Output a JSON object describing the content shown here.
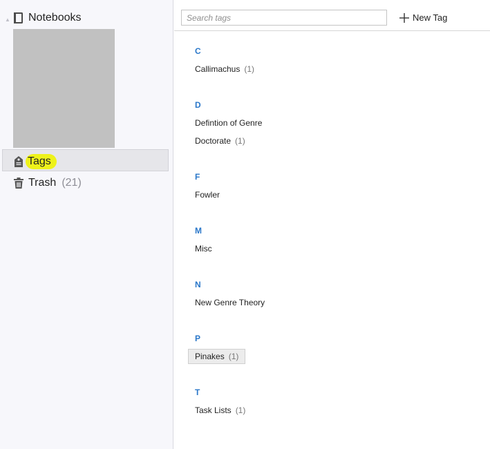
{
  "sidebar": {
    "notebooks_label": "Notebooks",
    "tags_label": "Tags",
    "trash_label": "Trash",
    "trash_count": "(21)",
    "highlight_color": "#eef21a"
  },
  "toolbar": {
    "search_placeholder": "Search tags",
    "new_tag_label": "New Tag"
  },
  "groups": [
    {
      "letter": "C",
      "tags": [
        {
          "name": "Callimachus",
          "count": "(1)"
        }
      ]
    },
    {
      "letter": "D",
      "tags": [
        {
          "name": "Defintion of Genre",
          "count": ""
        },
        {
          "name": "Doctorate",
          "count": "(1)"
        }
      ]
    },
    {
      "letter": "F",
      "tags": [
        {
          "name": "Fowler",
          "count": ""
        }
      ]
    },
    {
      "letter": "M",
      "tags": [
        {
          "name": "Misc",
          "count": ""
        }
      ]
    },
    {
      "letter": "N",
      "tags": [
        {
          "name": "New Genre Theory",
          "count": ""
        }
      ]
    },
    {
      "letter": "P",
      "tags": [
        {
          "name": "Pinakes",
          "count": "(1)"
        }
      ]
    },
    {
      "letter": "T",
      "tags": [
        {
          "name": "Task Lists",
          "count": "(1)"
        }
      ]
    }
  ]
}
